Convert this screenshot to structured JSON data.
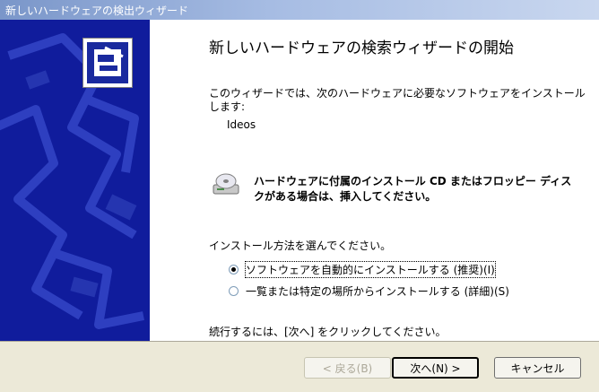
{
  "window": {
    "title": "新しいハードウェアの検出ウィザード"
  },
  "content": {
    "heading": "新しいハードウェアの検索ウィザードの開始",
    "intro": "このウィザードでは、次のハードウェアに必要なソフトウェアをインストールします:",
    "device_name": "Ideos",
    "cd_notice": "ハードウェアに付属のインストール CD またはフロッピー ディスクがある場合は、挿入してください。",
    "method_label": "インストール方法を選んでください。",
    "options": [
      {
        "label": "ソフトウェアを自動的にインストールする (推奨)(I)",
        "selected": true
      },
      {
        "label": "一覧または特定の場所からインストールする (詳細)(S)",
        "selected": false
      }
    ],
    "continue_text": "続行するには、[次へ] をクリックしてください。"
  },
  "buttons": {
    "back": "< 戻る(B)",
    "next": "次へ(N) >",
    "cancel": "キャンセル"
  },
  "icons": {
    "wizard": "hardware-wizard-icon",
    "cd": "cd-drive-icon"
  },
  "colors": {
    "side_panel": "#101C9C",
    "title_bar": "#7A96C9",
    "dialog_bg": "#ECE9D8"
  }
}
